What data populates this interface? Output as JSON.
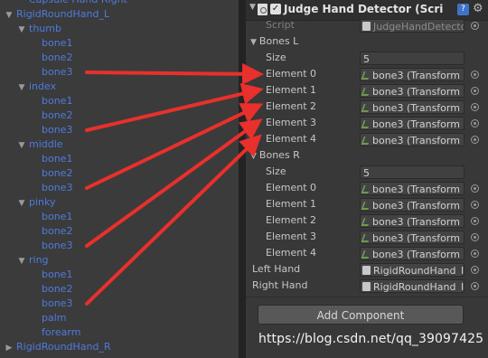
{
  "hierarchy": {
    "items": [
      {
        "label": "Capsule Hand Right",
        "depth": 1,
        "fold": ""
      },
      {
        "label": "RigidRoundHand_L",
        "depth": 0,
        "fold": "down"
      },
      {
        "label": "thumb",
        "depth": 1,
        "fold": "down"
      },
      {
        "label": "bone1",
        "depth": 3,
        "fold": ""
      },
      {
        "label": "bone2",
        "depth": 3,
        "fold": ""
      },
      {
        "label": "bone3",
        "depth": 3,
        "fold": ""
      },
      {
        "label": "index",
        "depth": 1,
        "fold": "down"
      },
      {
        "label": "bone1",
        "depth": 3,
        "fold": ""
      },
      {
        "label": "bone2",
        "depth": 3,
        "fold": ""
      },
      {
        "label": "bone3",
        "depth": 3,
        "fold": ""
      },
      {
        "label": "middle",
        "depth": 1,
        "fold": "down"
      },
      {
        "label": "bone1",
        "depth": 3,
        "fold": ""
      },
      {
        "label": "bone2",
        "depth": 3,
        "fold": ""
      },
      {
        "label": "bone3",
        "depth": 3,
        "fold": ""
      },
      {
        "label": "pinky",
        "depth": 1,
        "fold": "down"
      },
      {
        "label": "bone1",
        "depth": 3,
        "fold": ""
      },
      {
        "label": "bone2",
        "depth": 3,
        "fold": ""
      },
      {
        "label": "bone3",
        "depth": 3,
        "fold": ""
      },
      {
        "label": "ring",
        "depth": 1,
        "fold": "down"
      },
      {
        "label": "bone1",
        "depth": 3,
        "fold": ""
      },
      {
        "label": "bone2",
        "depth": 3,
        "fold": ""
      },
      {
        "label": "bone3",
        "depth": 3,
        "fold": ""
      },
      {
        "label": "palm",
        "depth": 2,
        "fold": ""
      },
      {
        "label": "forearm",
        "depth": 2,
        "fold": ""
      },
      {
        "label": "RigidRoundHand_R",
        "depth": 0,
        "fold": "right"
      }
    ]
  },
  "inspector": {
    "component_title": "Judge Hand Detector (Scri",
    "enabled": true,
    "script_label": "Script",
    "script_value": "JudgeHandDetecto",
    "bones_l": {
      "label": "Bones L",
      "size_label": "Size",
      "size_value": "5",
      "elements": [
        {
          "label": "Element 0",
          "value": "bone3 (Transform"
        },
        {
          "label": "Element 1",
          "value": "bone3 (Transform"
        },
        {
          "label": "Element 2",
          "value": "bone3 (Transform"
        },
        {
          "label": "Element 3",
          "value": "bone3 (Transform"
        },
        {
          "label": "Element 4",
          "value": "bone3 (Transform"
        }
      ]
    },
    "bones_r": {
      "label": "Bones R",
      "size_label": "Size",
      "size_value": "5",
      "elements": [
        {
          "label": "Element 0",
          "value": "bone3 (Transform"
        },
        {
          "label": "Element 1",
          "value": "bone3 (Transform"
        },
        {
          "label": "Element 2",
          "value": "bone3 (Transform"
        },
        {
          "label": "Element 3",
          "value": "bone3 (Transform"
        },
        {
          "label": "Element 4",
          "value": "bone3 (Transform"
        }
      ]
    },
    "left_hand": {
      "label": "Left Hand",
      "value": "RigidRoundHand_I"
    },
    "right_hand": {
      "label": "Right Hand",
      "value": "RigidRoundHand_I"
    },
    "add_component_label": "Add Component"
  },
  "watermark": "https://blog.csdn.net/qq_39097425",
  "colors": {
    "hierarchy_text": "#4f7bde",
    "arrow": "#e8302c",
    "panel_bg": "#383838"
  }
}
